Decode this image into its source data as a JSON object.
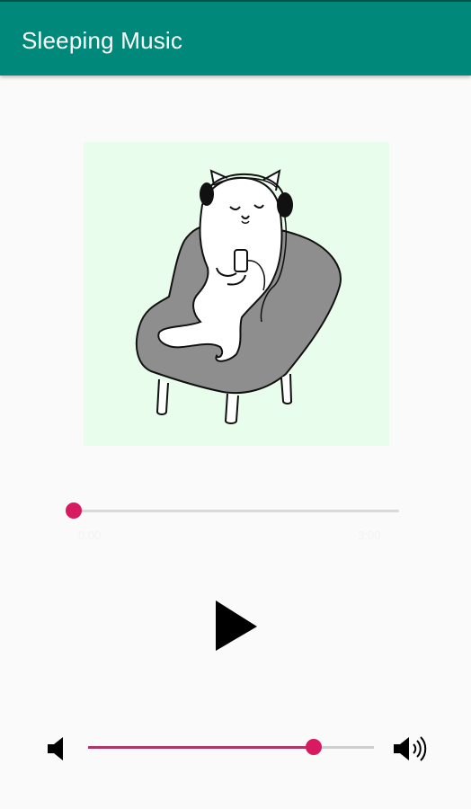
{
  "app": {
    "title": "Sleeping Music"
  },
  "artwork": {
    "icon": "cat-listening-music-illustration",
    "background": "#e8fdeb"
  },
  "player": {
    "position_fraction": 0.0,
    "current_time": "0:00",
    "total_time": "3:00",
    "play_icon": "play-icon"
  },
  "volume": {
    "level_fraction": 0.79,
    "low_icon": "volume-low-icon",
    "high_icon": "volume-high-icon"
  },
  "colors": {
    "appbar": "#00897b",
    "accent": "#d81b60",
    "background": "#fafafa"
  }
}
